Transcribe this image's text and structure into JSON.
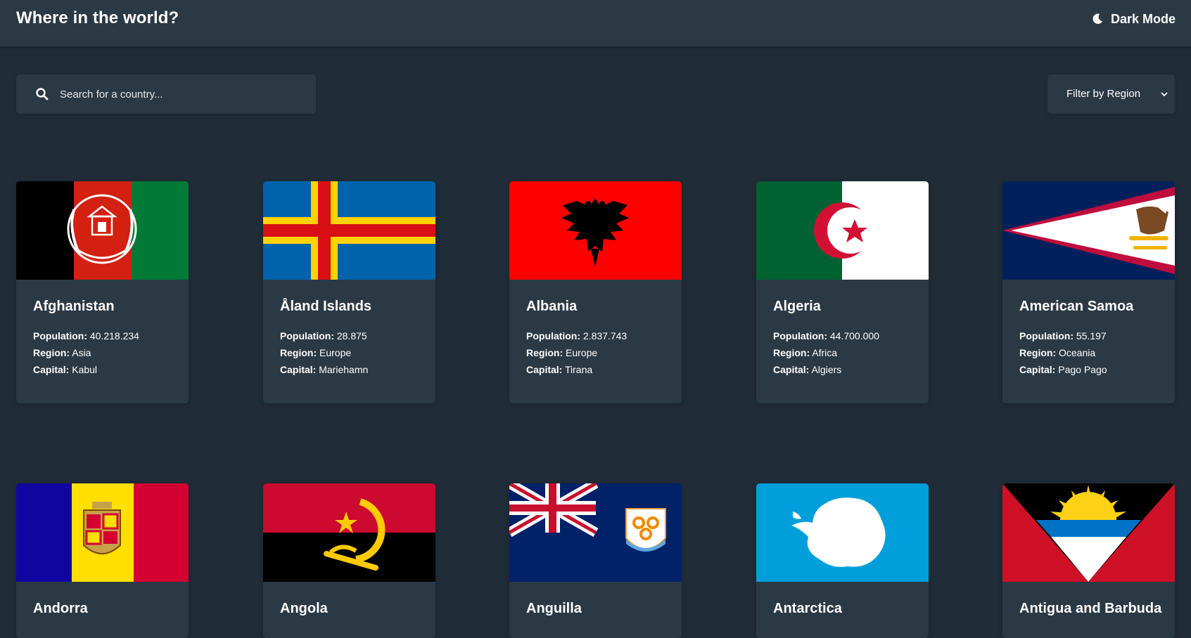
{
  "header": {
    "title": "Where in the world?",
    "mode_label": "Dark Mode",
    "mode_icon": "moon-icon"
  },
  "search": {
    "placeholder": "Search for a country...",
    "icon": "search-icon"
  },
  "filter": {
    "label": "Filter by Region",
    "icon": "chevron-down-icon"
  },
  "labels": {
    "population": "Population:",
    "region": "Region:",
    "capital": "Capital:"
  },
  "countries": [
    {
      "name": "Afghanistan",
      "population": "40.218.234",
      "region": "Asia",
      "capital": "Kabul"
    },
    {
      "name": "Åland Islands",
      "population": "28.875",
      "region": "Europe",
      "capital": "Mariehamn"
    },
    {
      "name": "Albania",
      "population": "2.837.743",
      "region": "Europe",
      "capital": "Tirana"
    },
    {
      "name": "Algeria",
      "population": "44.700.000",
      "region": "Africa",
      "capital": "Algiers"
    },
    {
      "name": "American Samoa",
      "population": "55.197",
      "region": "Oceania",
      "capital": "Pago Pago"
    },
    {
      "name": "Andorra"
    },
    {
      "name": "Angola"
    },
    {
      "name": "Anguilla"
    },
    {
      "name": "Antarctica"
    },
    {
      "name": "Antigua and Barbuda"
    }
  ],
  "colors": {
    "background": "#202c37",
    "surface": "#2b3945",
    "text": "#ffffff"
  }
}
